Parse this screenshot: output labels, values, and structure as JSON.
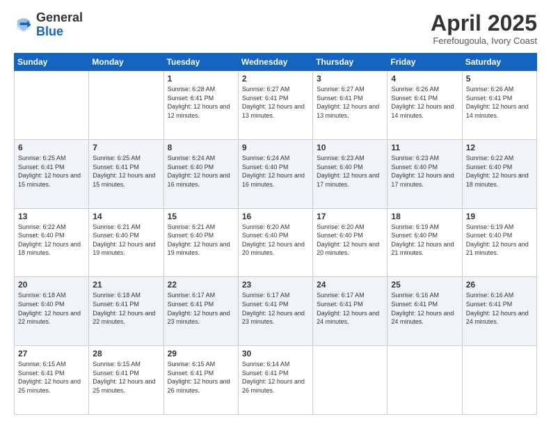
{
  "logo": {
    "general": "General",
    "blue": "Blue"
  },
  "header": {
    "month": "April 2025",
    "location": "Ferefougoula, Ivory Coast"
  },
  "days": [
    "Sunday",
    "Monday",
    "Tuesday",
    "Wednesday",
    "Thursday",
    "Friday",
    "Saturday"
  ],
  "weeks": [
    [
      {
        "num": "",
        "info": ""
      },
      {
        "num": "",
        "info": ""
      },
      {
        "num": "1",
        "info": "Sunrise: 6:28 AM\nSunset: 6:41 PM\nDaylight: 12 hours and 12 minutes."
      },
      {
        "num": "2",
        "info": "Sunrise: 6:27 AM\nSunset: 6:41 PM\nDaylight: 12 hours and 13 minutes."
      },
      {
        "num": "3",
        "info": "Sunrise: 6:27 AM\nSunset: 6:41 PM\nDaylight: 12 hours and 13 minutes."
      },
      {
        "num": "4",
        "info": "Sunrise: 6:26 AM\nSunset: 6:41 PM\nDaylight: 12 hours and 14 minutes."
      },
      {
        "num": "5",
        "info": "Sunrise: 6:26 AM\nSunset: 6:41 PM\nDaylight: 12 hours and 14 minutes."
      }
    ],
    [
      {
        "num": "6",
        "info": "Sunrise: 6:25 AM\nSunset: 6:41 PM\nDaylight: 12 hours and 15 minutes."
      },
      {
        "num": "7",
        "info": "Sunrise: 6:25 AM\nSunset: 6:41 PM\nDaylight: 12 hours and 15 minutes."
      },
      {
        "num": "8",
        "info": "Sunrise: 6:24 AM\nSunset: 6:40 PM\nDaylight: 12 hours and 16 minutes."
      },
      {
        "num": "9",
        "info": "Sunrise: 6:24 AM\nSunset: 6:40 PM\nDaylight: 12 hours and 16 minutes."
      },
      {
        "num": "10",
        "info": "Sunrise: 6:23 AM\nSunset: 6:40 PM\nDaylight: 12 hours and 17 minutes."
      },
      {
        "num": "11",
        "info": "Sunrise: 6:23 AM\nSunset: 6:40 PM\nDaylight: 12 hours and 17 minutes."
      },
      {
        "num": "12",
        "info": "Sunrise: 6:22 AM\nSunset: 6:40 PM\nDaylight: 12 hours and 18 minutes."
      }
    ],
    [
      {
        "num": "13",
        "info": "Sunrise: 6:22 AM\nSunset: 6:40 PM\nDaylight: 12 hours and 18 minutes."
      },
      {
        "num": "14",
        "info": "Sunrise: 6:21 AM\nSunset: 6:40 PM\nDaylight: 12 hours and 19 minutes."
      },
      {
        "num": "15",
        "info": "Sunrise: 6:21 AM\nSunset: 6:40 PM\nDaylight: 12 hours and 19 minutes."
      },
      {
        "num": "16",
        "info": "Sunrise: 6:20 AM\nSunset: 6:40 PM\nDaylight: 12 hours and 20 minutes."
      },
      {
        "num": "17",
        "info": "Sunrise: 6:20 AM\nSunset: 6:40 PM\nDaylight: 12 hours and 20 minutes."
      },
      {
        "num": "18",
        "info": "Sunrise: 6:19 AM\nSunset: 6:40 PM\nDaylight: 12 hours and 21 minutes."
      },
      {
        "num": "19",
        "info": "Sunrise: 6:19 AM\nSunset: 6:40 PM\nDaylight: 12 hours and 21 minutes."
      }
    ],
    [
      {
        "num": "20",
        "info": "Sunrise: 6:18 AM\nSunset: 6:40 PM\nDaylight: 12 hours and 22 minutes."
      },
      {
        "num": "21",
        "info": "Sunrise: 6:18 AM\nSunset: 6:41 PM\nDaylight: 12 hours and 22 minutes."
      },
      {
        "num": "22",
        "info": "Sunrise: 6:17 AM\nSunset: 6:41 PM\nDaylight: 12 hours and 23 minutes."
      },
      {
        "num": "23",
        "info": "Sunrise: 6:17 AM\nSunset: 6:41 PM\nDaylight: 12 hours and 23 minutes."
      },
      {
        "num": "24",
        "info": "Sunrise: 6:17 AM\nSunset: 6:41 PM\nDaylight: 12 hours and 24 minutes."
      },
      {
        "num": "25",
        "info": "Sunrise: 6:16 AM\nSunset: 6:41 PM\nDaylight: 12 hours and 24 minutes."
      },
      {
        "num": "26",
        "info": "Sunrise: 6:16 AM\nSunset: 6:41 PM\nDaylight: 12 hours and 24 minutes."
      }
    ],
    [
      {
        "num": "27",
        "info": "Sunrise: 6:15 AM\nSunset: 6:41 PM\nDaylight: 12 hours and 25 minutes."
      },
      {
        "num": "28",
        "info": "Sunrise: 6:15 AM\nSunset: 6:41 PM\nDaylight: 12 hours and 25 minutes."
      },
      {
        "num": "29",
        "info": "Sunrise: 6:15 AM\nSunset: 6:41 PM\nDaylight: 12 hours and 26 minutes."
      },
      {
        "num": "30",
        "info": "Sunrise: 6:14 AM\nSunset: 6:41 PM\nDaylight: 12 hours and 26 minutes."
      },
      {
        "num": "",
        "info": ""
      },
      {
        "num": "",
        "info": ""
      },
      {
        "num": "",
        "info": ""
      }
    ]
  ]
}
